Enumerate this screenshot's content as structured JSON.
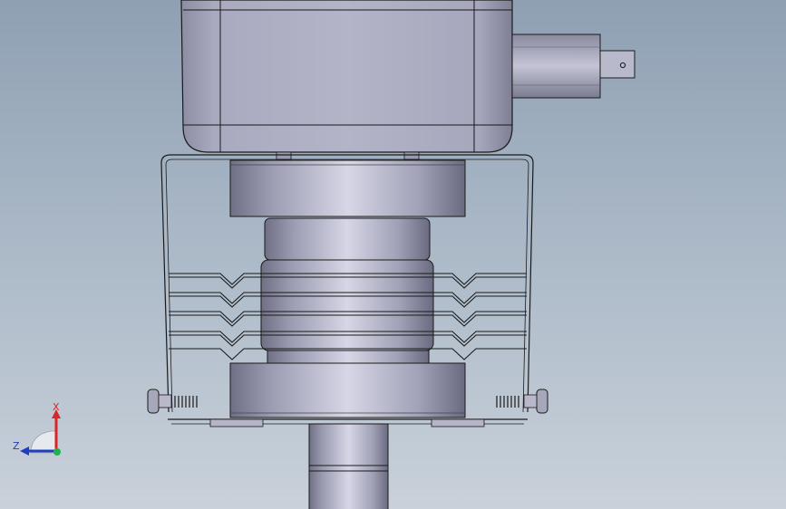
{
  "viewport": {
    "background_top": "#8fa0b3",
    "background_bottom": "#c9d1da",
    "model": {
      "parts": [
        "housing-block",
        "connector-stub",
        "wire-guard-frame",
        "upper-disc",
        "load-cell-body",
        "lower-disc",
        "base-shaft"
      ]
    }
  },
  "triad": {
    "x_label": "X",
    "z_label": "Z",
    "x_color": "#d8262a",
    "z_color": "#1f3fbf",
    "y_color": "#22b14c"
  }
}
